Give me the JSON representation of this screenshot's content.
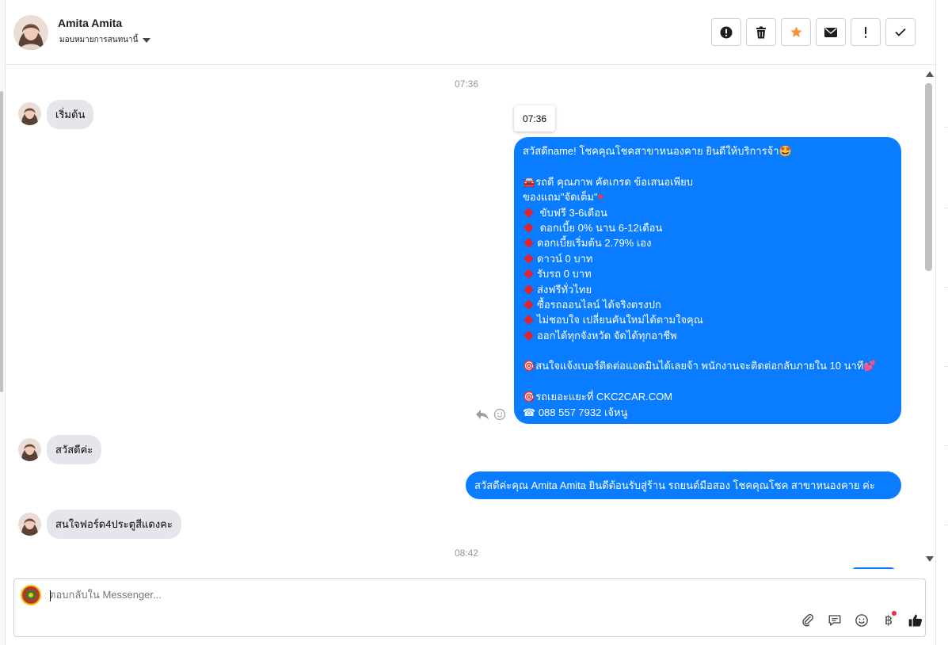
{
  "header": {
    "name": "Amita Amita",
    "assign_label": "มอบหมายการสนทนานี้",
    "actions": [
      "alert-circle-icon",
      "trash-icon",
      "star-icon",
      "envelope-icon",
      "exclamation-icon",
      "check-icon"
    ],
    "star_color": "#f7923a"
  },
  "thread": {
    "time_1": "07:36",
    "tooltip_time": "07:36",
    "msg_in_1": "เริ่มต้น",
    "big_message": {
      "l1": "สวัสดีname! โชคคุณโชคสาขาหนองคาย ยินดีให้บริการจ้า",
      "l3": "รถดี คุณภาพ คัดเกรด ข้อเสนอเพียบ",
      "l4": "ของแถม\"จัดเต็ม\"",
      "l5": " ขับฟรี 3-6เดือน",
      "l6": " ดอกเบี้ย 0% นาน 6-12เดือน",
      "l7": "ดอกเบี้ยเริ่มต้น 2.79% เอง",
      "l8": "ดาวน์ 0 บาท",
      "l9": "รับรถ 0 บาท",
      "l10": "ส่งฟรีทั่วไทย",
      "l11": "ซื้อรถออนไลน์ ได้จริงตรงปก",
      "l12": "ไม่ชอบใจ เปลี่ยนคันใหม่ได้ตามใจคุณ",
      "l13": "ออกได้ทุกจังหวัด จัดได้ทุกอาชีพ",
      "l15": "สนใจแจ้งเบอร์ติดต่อแอดมินได้เลยจ้า พนักงานจะติดต่อกลับภายใน 10 นาที",
      "l17": "รถเยอะแยะที่ CKC2CAR.COM",
      "l18": " 088 557 7932 เจ้หนู"
    },
    "msg_in_2": "สวัสดีค่ะ",
    "msg_out_2": "สวัสดีค่ะคุณ Amita Amita ยินดีต้อนรับสู่ร้าน รถยนต์มือสอง โชคคุณโชค สาขาหนองคาย ค่ะ",
    "msg_in_3": "สนใจฟอร์ด4ประตูสีแดงคะ",
    "time_2": "08:42",
    "bubble_color": "#0a7cff"
  },
  "composer": {
    "placeholder": "ตอบกลับใน Messenger...",
    "tools": [
      "paperclip-icon",
      "saved-reply-icon",
      "emoji-icon",
      "baht-icon",
      "thumbs-up-icon"
    ],
    "baht_symbol": "฿"
  }
}
